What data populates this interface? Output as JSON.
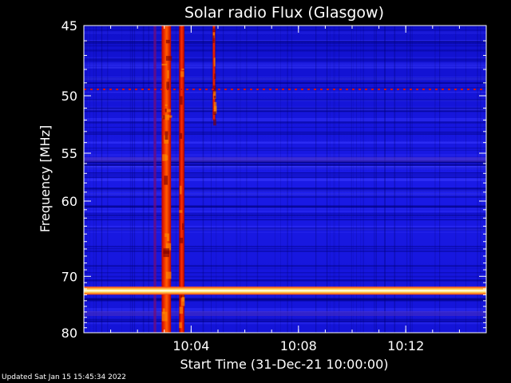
{
  "chart_data": {
    "type": "heatmap",
    "title": "Solar radio Flux (Glasgow)",
    "xlabel": "Start Time (31-Dec-21 10:00:00)",
    "ylabel": "Frequency [MHz]",
    "x_unit": "minutes after 10:00:00",
    "xlim": [
      0,
      15
    ],
    "ylim": [
      45,
      80
    ],
    "y_scale": "reciprocal",
    "x_ticks": [
      {
        "label": "10:04",
        "minutes": 4
      },
      {
        "label": "10:08",
        "minutes": 8
      },
      {
        "label": "10:12",
        "minutes": 12
      }
    ],
    "y_ticks": [
      45,
      50,
      55,
      60,
      70,
      80
    ],
    "colormap": [
      "#000066",
      "#1a1aff",
      "#b00000",
      "#ff4000",
      "#ffd000",
      "#ffffff"
    ],
    "background_color": "#1a1aee",
    "features": [
      {
        "kind": "burst",
        "start_min": 2.9,
        "end_min": 3.25,
        "freq_range": [
          45,
          80
        ],
        "intensity": "high"
      },
      {
        "kind": "burst",
        "start_min": 3.55,
        "end_min": 3.75,
        "freq_range": [
          45,
          80
        ],
        "intensity": "medium"
      },
      {
        "kind": "burst",
        "start_min": 2.6,
        "end_min": 2.7,
        "freq_range": [
          45,
          80
        ],
        "intensity": "low"
      },
      {
        "kind": "burst",
        "start_min": 4.8,
        "end_min": 4.9,
        "freq_range": [
          45,
          52
        ],
        "intensity": "medium"
      },
      {
        "kind": "interference",
        "freq_mhz": 72.3,
        "intensity": "high"
      },
      {
        "kind": "interference",
        "freq_mhz": 49.5,
        "intensity": "medium"
      },
      {
        "kind": "band",
        "freq_mhz": 55.6,
        "intensity": "low"
      },
      {
        "kind": "band",
        "freq_mhz": 76.3,
        "intensity": "low"
      }
    ]
  },
  "footer": {
    "updated": "Updated Sat Jan 15 15:45:34 2022"
  }
}
